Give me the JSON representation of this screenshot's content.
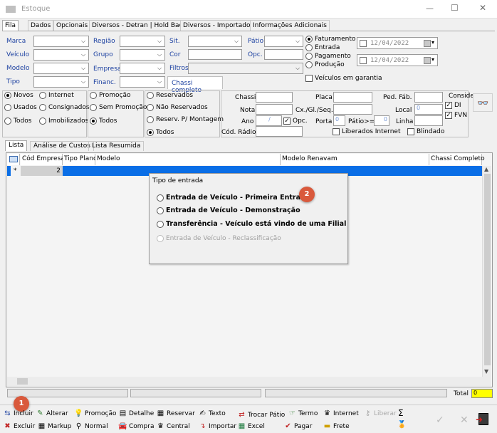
{
  "window": {
    "title": "Estoque",
    "min": "—",
    "max": "☐",
    "close": "✕"
  },
  "tabs": [
    "Fila",
    "Dados",
    "Opcionais",
    "Diversos - Detran | Hold Back",
    "Diversos - Importados",
    "Informações Adicionais"
  ],
  "filters": {
    "marca": "Marca",
    "veiculo": "Veículo",
    "modelo": "Modelo",
    "tipo": "Tipo",
    "regiao": "Região",
    "grupo": "Grupo",
    "empresa": "Empresa",
    "financ": "Financ.",
    "sit": "Sit.",
    "cor": "Cor",
    "filtros": "Filtros",
    "chassi_completo": "Chassi completo",
    "patio": "Pátio",
    "opc": "Opc."
  },
  "date_radios": {
    "faturamento": "Faturamento",
    "entrada": "Entrada",
    "pagamento": "Pagamento",
    "producao": "Produção",
    "garantia": "Veículos em garantia"
  },
  "dates": {
    "d1": "12/04/2022",
    "d2": "12/04/2022"
  },
  "status": {
    "novos": "Novos",
    "usados": "Usados",
    "todos": "Todos",
    "internet": "Internet",
    "consignados": "Consignados",
    "imobilizados": "Imobilizados",
    "promocao": "Promoção",
    "sem_promocao": "Sem Promoção",
    "todos2": "Todos",
    "reservados": "Reservados",
    "nao_reservados": "Não Reservados",
    "reserv_montagem": "Reserv. P/ Montagem",
    "todos3": "Todos"
  },
  "fields": {
    "chassi": "Chassi",
    "placa": "Placa",
    "ped_fab": "Ped. Fáb.",
    "nota": "Nota",
    "cx": "Cx./Gl./Seq.",
    "local": "Local",
    "local_val": "0",
    "ano": "Ano",
    "ano_sep": "/",
    "opc": "Opc.",
    "porta": "Porta",
    "porta_val": "0",
    "patio_ge": "Pátio>=",
    "patio_val": "0",
    "linha": "Linha",
    "cod_radio": "Cód. Rádio",
    "liberados": "Liberados Internet",
    "blindado": "Blindado",
    "consider": "Conside",
    "di": "DI",
    "fvn": "FVN"
  },
  "subtabs": [
    "Lista",
    "Análise de Custos",
    "Lista Resumida"
  ],
  "grid": {
    "headers": [
      "Cód Empresa",
      "Tipo Plano",
      "Modelo",
      "Modelo Renavam",
      "Chassi Completo"
    ],
    "row_marker": "*",
    "row_value": "2"
  },
  "popup": {
    "title": "Tipo de entrada",
    "options": [
      "Entrada de Veículo - Primeira Entrada",
      "Entrada de Veículo - Demonstração",
      "Transferência - Veículo está vindo de uma Filial",
      "Entrada de Veículo - Reclassificação"
    ],
    "badge": "2"
  },
  "footer": {
    "total_label": "Total",
    "total_value": "0",
    "badge": "1"
  },
  "toolbar_row1": [
    "Incluir",
    "Alterar",
    "Promoção",
    "Detalhe",
    "Reservar",
    "Texto",
    "Trocar Pátio",
    "Termo",
    "Internet",
    "Liberar",
    "Σ"
  ],
  "toolbar_row2": [
    "Excluir",
    "Markup",
    "Normal",
    "Compra",
    "Central",
    "Importar",
    "Excel",
    "Pagar",
    "Frete"
  ]
}
